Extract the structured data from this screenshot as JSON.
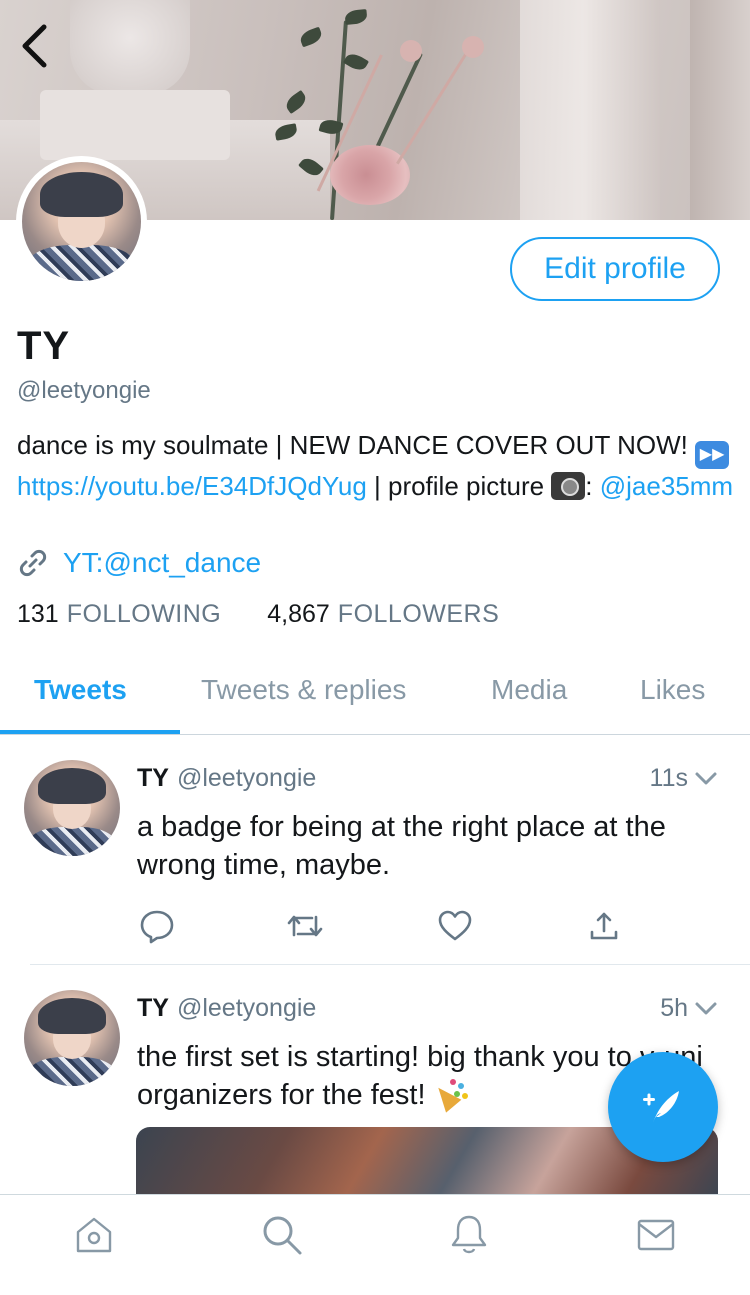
{
  "header": {
    "back_icon": "chevron-left-icon"
  },
  "profile": {
    "display_name": "TY",
    "handle": "@leetyongie",
    "edit_button_label": "Edit profile",
    "bio": {
      "text_1": "dance is my soulmate | NEW DANCE COVER OUT NOW!",
      "emoji_1": "fast-forward-emoji",
      "link": "https://youtu.be/E34DfJQdYug",
      "text_2": " | profile picture",
      "emoji_2": "camera-emoji",
      "text_3": ":",
      "mention": "@jae35mm"
    },
    "website": "YT:@nct_dance",
    "following_count": "131",
    "following_label": "FOLLOWING",
    "followers_count": "4,867",
    "followers_label": "FOLLOWERS"
  },
  "tabs": [
    {
      "label": "Tweets",
      "active": true
    },
    {
      "label": "Tweets & replies",
      "active": false
    },
    {
      "label": "Media",
      "active": false
    },
    {
      "label": "Likes",
      "active": false
    }
  ],
  "tweets": [
    {
      "name": "TY",
      "handle": "@leetyongie",
      "time": "11s",
      "text": "a badge for being at the right place at the wrong time, maybe."
    },
    {
      "name": "TY",
      "handle": "@leetyongie",
      "time": "5h",
      "text": "the first set is starting! big thank you to v-uni organizers for the fest!",
      "emoji": "party-popper-emoji"
    }
  ],
  "colors": {
    "accent": "#1da1f2",
    "text_primary": "#14171a",
    "text_secondary": "#657786"
  },
  "fab_icon": "compose-tweet-icon",
  "bottom_bar": [
    "home-icon",
    "search-icon",
    "notifications-bell-icon",
    "messages-envelope-icon"
  ]
}
